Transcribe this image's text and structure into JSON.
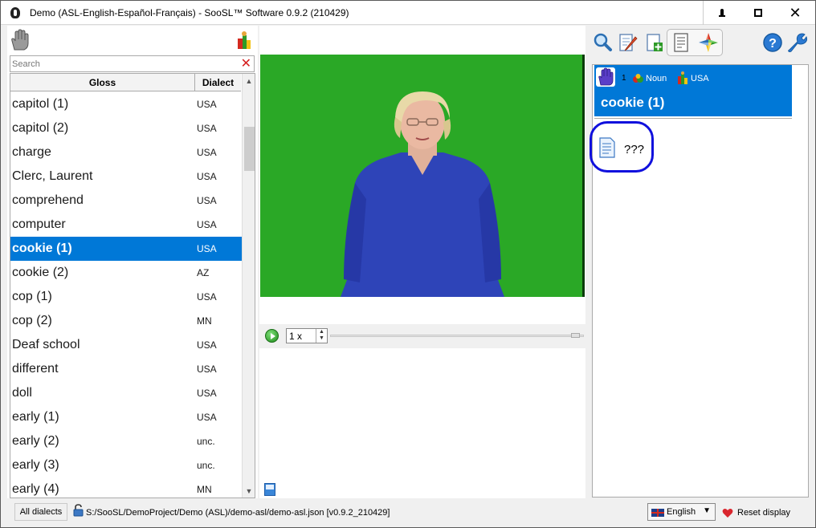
{
  "window": {
    "title": "Demo (ASL-English-Español-Français) - SooSL™ Software 0.9.2 (210429)",
    "close_glyph": "✕"
  },
  "left_panel": {
    "search_placeholder": "Search",
    "columns": {
      "gloss": "Gloss",
      "dialect": "Dialect"
    },
    "rows": [
      {
        "gloss": "capitol (1)",
        "dialect": "USA"
      },
      {
        "gloss": "capitol (2)",
        "dialect": "USA"
      },
      {
        "gloss": "charge",
        "dialect": "USA"
      },
      {
        "gloss": "Clerc, Laurent",
        "dialect": "USA"
      },
      {
        "gloss": "comprehend",
        "dialect": "USA"
      },
      {
        "gloss": "computer",
        "dialect": "USA"
      },
      {
        "gloss": "cookie (1)",
        "dialect": "USA",
        "selected": true
      },
      {
        "gloss": "cookie (2)",
        "dialect": "AZ"
      },
      {
        "gloss": "cop (1)",
        "dialect": "USA"
      },
      {
        "gloss": "cop (2)",
        "dialect": "MN"
      },
      {
        "gloss": "Deaf school",
        "dialect": "USA"
      },
      {
        "gloss": "different",
        "dialect": "USA"
      },
      {
        "gloss": "doll",
        "dialect": "USA"
      },
      {
        "gloss": "early (1)",
        "dialect": "USA"
      },
      {
        "gloss": "early (2)",
        "dialect": "unc."
      },
      {
        "gloss": "early (3)",
        "dialect": "unc."
      },
      {
        "gloss": "early (4)",
        "dialect": "MN"
      }
    ]
  },
  "player": {
    "speed": "1 x"
  },
  "sign_detail": {
    "sense_number": "1",
    "part_of_speech": "Noun",
    "dialect": "USA",
    "gloss": "cookie (1)",
    "sense_text": "???"
  },
  "status_bar": {
    "all_dialects_label": "All dialects",
    "project_path": "S:/SooSL/DemoProject/Demo (ASL)/demo-asl/demo-asl.json [v0.9.2_210429]",
    "language": "English",
    "reset_display_label": "Reset display"
  },
  "colors": {
    "selection": "#0078d7",
    "video_background": "#2aa826",
    "sense_highlight": "#1010dd"
  },
  "icons": [
    "hand-icon",
    "dialect-filter-icon",
    "search-icon",
    "edit-sign-icon",
    "add-sign-icon",
    "info-view-icon",
    "compass-view-icon",
    "help-icon",
    "settings-wrench-icon",
    "play-icon",
    "notes-icon",
    "lock-icon",
    "uk-flag-icon",
    "heart-icon",
    "document-icon"
  ]
}
